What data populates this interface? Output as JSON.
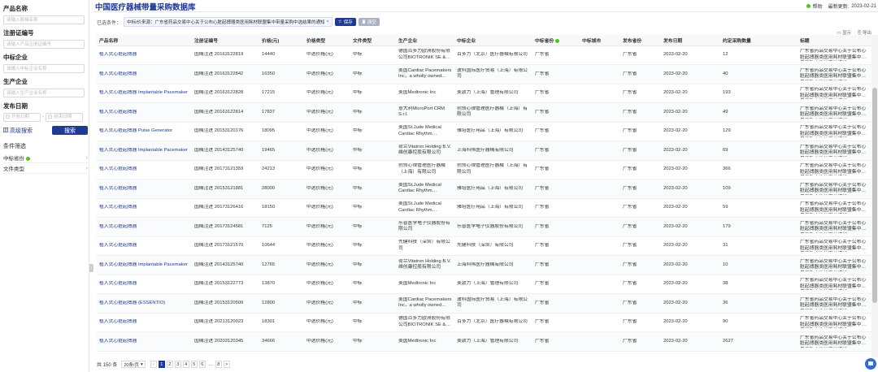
{
  "sidebar": {
    "fields": [
      {
        "label": "产品名称",
        "placeholder": "请输入器械名称"
      },
      {
        "label": "注册证编号",
        "placeholder": "请输入产品注册证编号"
      },
      {
        "label": "中标企业",
        "placeholder": "请输入中标企业名称"
      },
      {
        "label": "生产企业",
        "placeholder": "请输入生产企业名称"
      }
    ],
    "date_label": "发布日期",
    "date_start": "开始日期",
    "date_end": "结束日期",
    "date_sep": "-",
    "advanced_search": "高级搜索",
    "search_button": "搜索",
    "filter_section": "条件筛选",
    "filters": [
      {
        "label": "中标省份"
      },
      {
        "label": "文件类型"
      }
    ]
  },
  "header": {
    "title": "中国医疗器械带量采购数据库",
    "help": "帮助",
    "updated_label": "最新更新:",
    "updated_date": "2023-02-21"
  },
  "conditions": {
    "label": "已选条件：",
    "tag": "中标/价来源：广东省药品交易中心关于公布心脏起搏器类医用耗材联盟集中带量采购中选结果的通知",
    "save": "保存",
    "clear": "清空"
  },
  "view": {
    "display": "显示",
    "export": "导出"
  },
  "table": {
    "columns": [
      "产品名称",
      "注册证编号",
      "价格(元)",
      "价格类型",
      "文件类型",
      "生产企业",
      "中标企业",
      "中标省份",
      "中标城市",
      "发布省份",
      "发布日期",
      "约定采购数量",
      "标题"
    ],
    "rows": [
      [
        "植入式心脏起搏器",
        "国械注进 20163122819",
        "14440",
        "中选价格(元)",
        "中标",
        "德国百多力欧洲股份有限公司BIOTRONIK SE & Co. KG",
        "百多力（北京）医疗器械有限公司",
        "广东省",
        "",
        "广东省",
        "2023-02-20",
        "12",
        "广东省药品交易中心关于公布心脏起搏器类医用耗材联盟集中带量采购中选结果的通知"
      ],
      [
        "植入式心脏起搏器",
        "国械注进 20163122842",
        "16350",
        "中选价格(元)",
        "中标",
        "美国Cardiac Pacemakers Inc，a wholly owned subsidiary of Boston Scientific",
        "波科国际医疗贸易（上海）有限公司",
        "广东省",
        "",
        "广东省",
        "2023-02-20",
        "40",
        "广东省药品交易中心关于公布心脏起搏器类医用耗材联盟集中带量采购中选结果的通知"
      ],
      [
        "植入式心脏起搏器 Implantable Pacemaker",
        "国械注进 20163122828",
        "17215",
        "中选价格(元)",
        "中标",
        "美国Medtronic Inc",
        "美敦力（上海）管理有限公司",
        "广东省",
        "",
        "广东省",
        "2023-02-20",
        "193",
        "广东省药品交易中心关于公布心脏起搏器类医用耗材联盟集中带量采购中选结果的通知"
      ],
      [
        "植入式心脏起搏器",
        "国械注进 20163122814",
        "17837",
        "中选价格(元)",
        "中标",
        "意大利MicroPort CRM S.r.l.",
        "创领心律管理医疗器械（上海）有限公司",
        "广东省",
        "",
        "广东省",
        "2023-02-20",
        "49",
        "广东省药品交易中心关于公布心脏起搏器类医用耗材联盟集中带量采购中选结果的通知"
      ],
      [
        "植入式心脏起搏器 Pulse Generator",
        "国械注进 20153120176",
        "18095",
        "中选价格(元)",
        "中标",
        "美国St.Jude Medical Cardiac Rhythm Management Division",
        "雅培医疗用品（上海）有限公司",
        "广东省",
        "",
        "广东省",
        "2023-02-20",
        "129",
        "广东省药品交易中心关于公布心脏起搏器类医用耗材联盟集中带量采购中选结果的通知"
      ],
      [
        "植入式心脏起搏器 Implantable Pacemaker",
        "国械注进 20143125740",
        "19465",
        "中选价格(元)",
        "中标",
        "荷兰Vitatron Holding B.V. 维创康控股有限公司",
        "上海科伟医疗器械有限公司",
        "广东省",
        "",
        "广东省",
        "2023-02-20",
        "69",
        "广东省药品交易中心关于公布心脏起搏器类医用耗材联盟集中带量采购中选结果的通知"
      ],
      [
        "植入式心脏起搏器",
        "国械注进 20173121359",
        "24213",
        "中选价格(元)",
        "中标",
        "创领心律管理医疗器械（上海）有限公司",
        "创领心律管理医疗器械（上海）有限公司",
        "广东省",
        "",
        "广东省",
        "2023-02-20",
        "366",
        "广东省药品交易中心关于公布心脏起搏器类医用耗材联盟集中带量采购中选结果的通知"
      ],
      [
        "植入式心脏起搏器",
        "国械注进 20153121881",
        "28000",
        "中选价格(元)",
        "中标",
        "美国St.Jude Medical Cardiac Rhythm Management Division",
        "雅培医疗用品（上海）有限公司",
        "广东省",
        "",
        "广东省",
        "2023-02-20",
        "109",
        "广东省药品交易中心关于公布心脏起搏器类医用耗材联盟集中带量采购中选结果的通知"
      ],
      [
        "植入式心脏起搏器",
        "国械注进 20173126416",
        "18150",
        "中选价格(元)",
        "中标",
        "美国St.Jude Medical Cardiac Rhythm Management Division",
        "雅培医疗用品（上海）有限公司",
        "广东省",
        "",
        "广东省",
        "2023-02-20",
        "59",
        "广东省药品交易中心关于公布心脏起搏器类医用耗材联盟集中带量采购中选结果的通知"
      ],
      [
        "植入式心脏起搏器",
        "国械注进 20173124581",
        "7125",
        "中选价格(元)",
        "中标",
        "乐普医学电子仪器股份有限公司",
        "乐普医学电子仪器股份有限公司",
        "广东省",
        "",
        "广东省",
        "2023-02-20",
        "179",
        "广东省药品交易中心关于公布心脏起搏器类医用耗材联盟集中带量采购中选结果的通知"
      ],
      [
        "植入式心脏起搏器",
        "国械注进 20173121570",
        "10644",
        "中选价格(元)",
        "中标",
        "先健科技（深圳）有限公司",
        "先健科技（深圳）有限公司",
        "广东省",
        "",
        "广东省",
        "2023-02-20",
        "31",
        "广东省药品交易中心关于公布心脏起搏器类医用耗材联盟集中带量采购中选结果的通知"
      ],
      [
        "植入式心脏起搏器 Implantable Pacemaker",
        "国械注进 20143125740",
        "12765",
        "中选价格(元)",
        "中标",
        "荷兰Vitatron Holding B.V. 维创康控股有限公司",
        "上海科伟医疗器械有限公司",
        "广东省",
        "",
        "广东省",
        "2023-02-20",
        "10",
        "广东省药品交易中心关于公布心脏起搏器类医用耗材联盟集中带量采购中选结果的通知"
      ],
      [
        "植入式心脏起搏器",
        "国械注进 20153122773",
        "13870",
        "中选价格(元)",
        "中标",
        "美国Medtronic Inc",
        "美敦力（上海）管理有限公司",
        "广东省",
        "",
        "广东省",
        "2023-02-20",
        "38",
        "广东省药品交易中心关于公布心脏起搏器类医用耗材联盟集中带量采购中选结果的通知"
      ],
      [
        "植入式心脏起搏器 (ESSENTIO)",
        "国械注进 20153120509",
        "12800",
        "中选价格(元)",
        "中标",
        "美国Cardiac Pacemakers Inc，a wholly owned subsidiary of Boston Scientific",
        "波科国际医疗贸易（上海）有限公司",
        "广东省",
        "",
        "广东省",
        "2023-02-20",
        "36",
        "广东省药品交易中心关于公布心脏起搏器类医用耗材联盟集中带量采购中选结果的通知"
      ],
      [
        "植入式心脏起搏器",
        "国械注进 20213120023",
        "18301",
        "中选价格(元)",
        "中标",
        "德国百多力欧洲股份有限公司BIOTRONIK SE & Co. KG",
        "百多力（北京）医疗器械有限公司",
        "广东省",
        "",
        "广东省",
        "2023-02-20",
        "90",
        "广东省药品交易中心关于公布心脏起搏器类医用耗材联盟集中带量采购中选结果的通知"
      ],
      [
        "植入式心脏起搏器",
        "国械注进 20203120345",
        "34666",
        "中选价格(元)",
        "中标",
        "美国Medtronic Inc",
        "美敦力（上海）管理有限公司",
        "广东省",
        "",
        "广东省",
        "2023-02-20",
        "2627",
        "广东省药品交易中心关于公布心脏起搏器类医用耗材联盟集中带量采购中选结果的通知"
      ]
    ]
  },
  "pagination": {
    "total": "共 150 条",
    "page_size": "20条/页",
    "prev": "<",
    "pages": [
      "1",
      "2",
      "3",
      "4",
      "5",
      "6"
    ],
    "ellipsis": "...",
    "last": "8",
    "next": ">"
  },
  "colors": {
    "primary": "#1f3a93",
    "green": "#52c41a"
  }
}
